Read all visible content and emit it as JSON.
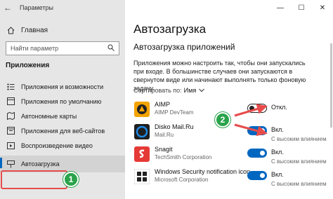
{
  "window": {
    "title": "Параметры",
    "controls": {
      "minimize": "—",
      "maximize": "☐",
      "close": "✕"
    }
  },
  "sidebar": {
    "back_icon": "back-arrow-icon",
    "home_label": "Главная",
    "search_placeholder": "Найти параметр",
    "section_label": "Приложения",
    "items": [
      {
        "label": "Приложения и возможности",
        "icon": "apps-list-icon",
        "selected": false
      },
      {
        "label": "Приложения по умолчанию",
        "icon": "default-apps-icon",
        "selected": false
      },
      {
        "label": "Автономные карты",
        "icon": "offline-maps-icon",
        "selected": false
      },
      {
        "label": "Приложения для веб-сайтов",
        "icon": "web-apps-icon",
        "selected": false
      },
      {
        "label": "Воспроизведение видео",
        "icon": "video-icon",
        "selected": false
      },
      {
        "label": "Автозагрузка",
        "icon": "startup-icon",
        "selected": true
      }
    ]
  },
  "main": {
    "page_title": "Автозагрузка",
    "subtitle": "Автозагрузка приложений",
    "description": "Приложения можно настроить так, чтобы они запускались при входе. В большинстве случаев они запускаются в свернутом виде или начинают выполнять только фоновую задачу.",
    "sort_label": "Сортировать по:",
    "sort_value": "Имя",
    "apps": [
      {
        "name": "AIMP",
        "publisher": "AIMP DevTeam",
        "state": "Откл.",
        "on": false,
        "impact": "",
        "icon": "aimp-icon"
      },
      {
        "name": "Disko Mail.Ru",
        "publisher": "Mail.Ru",
        "state": "Вкл.",
        "on": true,
        "impact": "С высоким влиянием",
        "icon": "disko-icon"
      },
      {
        "name": "Snagit",
        "publisher": "TechSmith Corporation",
        "state": "Вкл.",
        "on": true,
        "impact": "С высоким влиянием",
        "icon": "snagit-icon"
      },
      {
        "name": "Windows Security notification icon",
        "publisher": "Microsoft Corporation",
        "state": "Вкл.",
        "on": true,
        "impact": "С высоким влиянием",
        "icon": "windows-security-icon"
      }
    ]
  },
  "annotations": {
    "badge1": "1",
    "badge2": "2",
    "color": "#2aa34a",
    "arrow_color": "#e74c4c"
  },
  "colors": {
    "accent": "#0067c0",
    "sidebar_bg": "#e6e6e6"
  }
}
